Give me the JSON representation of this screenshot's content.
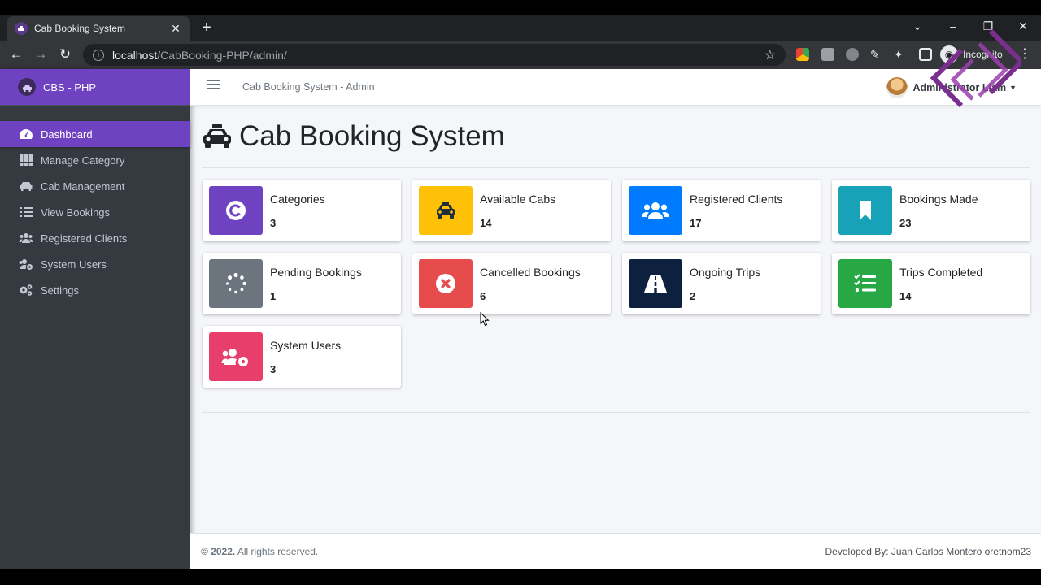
{
  "browser": {
    "tab_title": "Cab Booking System",
    "tab_close": "✕",
    "new_tab": "+",
    "url_host": "localhost",
    "url_path": "/CabBooking-PHP/admin/",
    "incognito_label": "Incognito",
    "win_controls": [
      "⌄",
      "–",
      "❐",
      "✕"
    ]
  },
  "sidebar": {
    "brand": "CBS - PHP",
    "items": [
      {
        "label": "Dashboard",
        "active": true,
        "icon": "tachometer-icon"
      },
      {
        "label": "Manage Category",
        "active": false,
        "icon": "grid-icon"
      },
      {
        "label": "Cab Management",
        "active": false,
        "icon": "car-icon"
      },
      {
        "label": "View Bookings",
        "active": false,
        "icon": "list-icon"
      },
      {
        "label": "Registered Clients",
        "active": false,
        "icon": "users-icon"
      },
      {
        "label": "System Users",
        "active": false,
        "icon": "users-cog-icon"
      },
      {
        "label": "Settings",
        "active": false,
        "icon": "cogs-icon"
      }
    ]
  },
  "topnav": {
    "title": "Cab Booking System - Admin",
    "user_name": "Administrator Liam"
  },
  "page": {
    "heading": "Cab Booking System"
  },
  "cards": [
    {
      "label": "Categories",
      "value": "3",
      "color": "#6f42c1",
      "icon": "copyright-icon"
    },
    {
      "label": "Available Cabs",
      "value": "14",
      "color": "#ffc107",
      "icon": "taxi-icon"
    },
    {
      "label": "Registered Clients",
      "value": "17",
      "color": "#007bff",
      "icon": "users-icon"
    },
    {
      "label": "Bookings Made",
      "value": "23",
      "color": "#17a2b8",
      "icon": "bookmark-icon"
    },
    {
      "label": "Pending Bookings",
      "value": "1",
      "color": "#6c757d",
      "icon": "spinner-icon"
    },
    {
      "label": "Cancelled Bookings",
      "value": "6",
      "color": "#e74c4c",
      "icon": "times-circle-icon"
    },
    {
      "label": "Ongoing Trips",
      "value": "2",
      "color": "#0d213f",
      "icon": "road-icon"
    },
    {
      "label": "Trips Completed",
      "value": "14",
      "color": "#28a745",
      "icon": "tasks-icon"
    },
    {
      "label": "System Users",
      "value": "3",
      "color": "#e83e6c",
      "icon": "users-cog-icon"
    }
  ],
  "footer": {
    "copyright_bold": "© 2022.",
    "copyright_rest": " All rights reserved.",
    "developer": "Developed By: Juan Carlos Montero oretnom23"
  },
  "colors": {
    "accent": "#6f42c1",
    "sidebar_bg": "#343a40",
    "page_bg": "#f4f6f9"
  }
}
